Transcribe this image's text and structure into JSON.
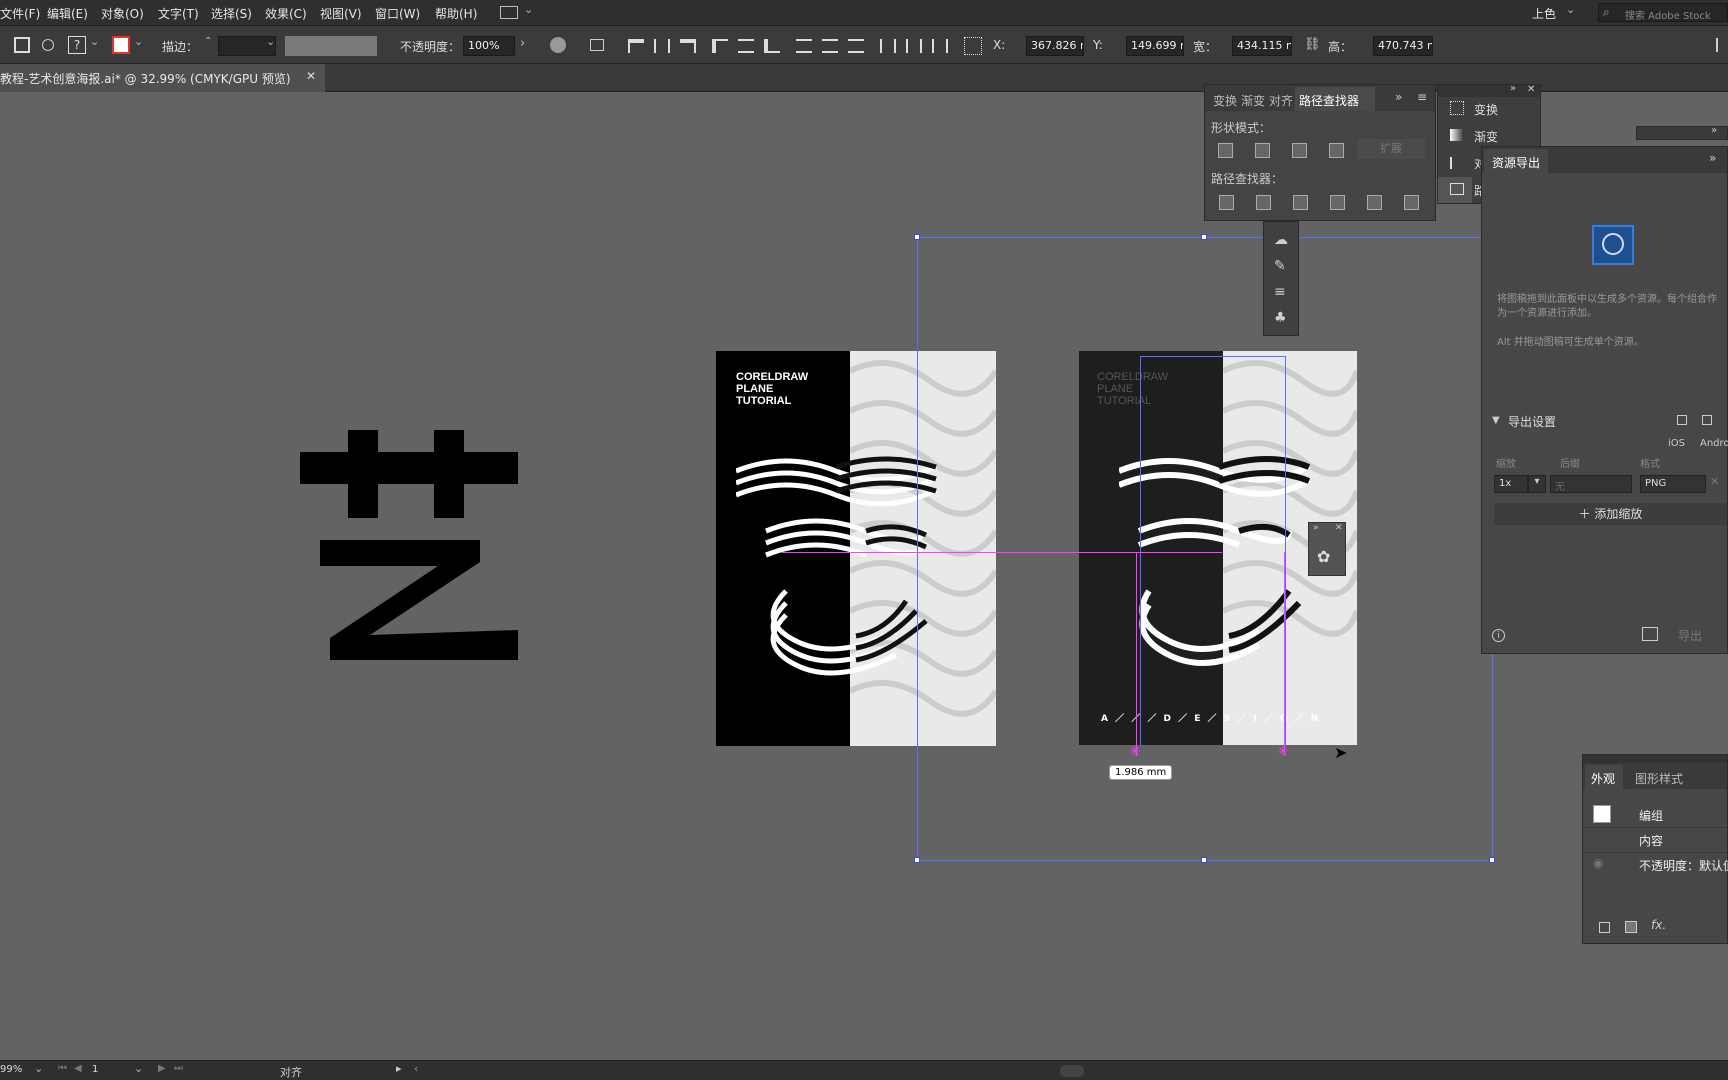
{
  "menubar": {
    "items": [
      "文件(F)",
      "编辑(E)",
      "对象(O)",
      "文字(T)",
      "选择(S)",
      "效果(C)",
      "视图(V)",
      "窗口(W)",
      "帮助(H)"
    ],
    "workspace": "上色",
    "search_placeholder": "搜索 Adobe Stock"
  },
  "control": {
    "stroke_label": "描边：",
    "opacity_label": "不透明度：",
    "opacity_value": "100%",
    "x_label": "X:",
    "x_value": "367.826 n",
    "y_label": "Y:",
    "y_value": "149.699 n",
    "w_label": "宽：",
    "w_value": "434.115 n",
    "h_label": "高：",
    "h_value": "470.743 n"
  },
  "document": {
    "tab_title": "教程-艺术创意海报.ai* @ 32.99% (CMYK/GPU 预览)"
  },
  "canvas": {
    "big_char": "艺",
    "poster_title_lines": [
      "CORELDRAW",
      "PLANE",
      "TUTORIAL"
    ],
    "poster_footer": "A ／ ／ ／ D ／ E ／ S ／ I ／ G ／ N",
    "measure_label": "1.986 mm"
  },
  "pathfinder": {
    "tabs": [
      "变换",
      "渐变",
      "对齐",
      "路径查找器"
    ],
    "shape_modes_label": "形状模式：",
    "expand_label": "扩展",
    "pathfinder_label": "路径查找器："
  },
  "mini_panel": {
    "items": [
      "变换",
      "渐变",
      "对齐",
      "路径查找器"
    ]
  },
  "asset_export": {
    "title": "资源导出",
    "hint1": "将图稿拖到此面板中以生成多个资源。每个组合作为一个资源进行添加。",
    "hint2": "Alt 并拖动图稿可生成单个资源。",
    "export_settings": "导出设置",
    "ios": "iOS",
    "android": "Android",
    "col_scale": "缩放",
    "col_suffix": "后缀",
    "col_format": "格式",
    "scale_value": "1x",
    "suffix_value": "无",
    "format_value": "PNG",
    "add_scale": "添加缩放",
    "export_btn": "导出"
  },
  "appearance": {
    "tabs": [
      "外观",
      "图形样式"
    ],
    "group_label": "编组",
    "content_label": "内容",
    "opacity_label": "不透明度：默认值"
  },
  "status": {
    "zoom": "99%",
    "page": "1",
    "tool": "对齐"
  }
}
